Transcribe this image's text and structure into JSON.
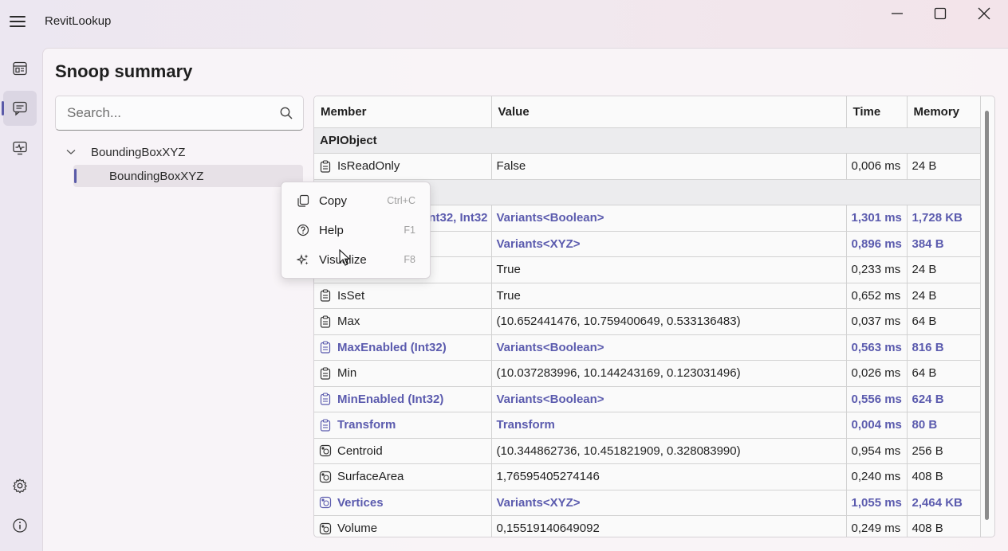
{
  "app": {
    "title": "RevitLookup"
  },
  "nav": {
    "items": [
      "dashboard-icon",
      "snoop-summary-icon",
      "monitor-icon",
      "settings-icon",
      "info-icon"
    ]
  },
  "page": {
    "title": "Snoop summary"
  },
  "search": {
    "placeholder": "Search..."
  },
  "tree": {
    "root": "BoundingBoxXYZ",
    "child": "BoundingBoxXYZ"
  },
  "table": {
    "headers": {
      "member": "Member",
      "value": "Value",
      "time": "Time",
      "memory": "Memory"
    },
    "groups": {
      "g1": "APIObject",
      "g2": ""
    },
    "rows": [
      {
        "icon": "property-icon",
        "member": "IsReadOnly",
        "value": "False",
        "time": "0,006 ms",
        "memory": "24 B"
      },
      {
        "icon": "property-icon",
        "member": "nt32, Int32",
        "value": "Variants<Boolean>",
        "time": "1,301 ms",
        "memory": "1,728 KB"
      },
      {
        "icon": "property-icon",
        "member": "",
        "value": "Variants<XYZ>",
        "time": "0,896 ms",
        "memory": "384 B"
      },
      {
        "icon": "property-icon",
        "member": "",
        "value": "True",
        "time": "0,233 ms",
        "memory": "24 B"
      },
      {
        "icon": "property-icon",
        "member": "IsSet",
        "value": "True",
        "time": "0,652 ms",
        "memory": "24 B"
      },
      {
        "icon": "property-icon",
        "member": "Max",
        "value": "(10.652441476, 10.759400649, 0.533136483)",
        "time": "0,037 ms",
        "memory": "64 B"
      },
      {
        "icon": "property-icon",
        "member": "MaxEnabled (Int32)",
        "value": "Variants<Boolean>",
        "time": "0,563 ms",
        "memory": "816 B"
      },
      {
        "icon": "property-icon",
        "member": "Min",
        "value": "(10.037283996, 10.144243169, 0.123031496)",
        "time": "0,026 ms",
        "memory": "64 B"
      },
      {
        "icon": "property-icon",
        "member": "MinEnabled (Int32)",
        "value": "Variants<Boolean>",
        "time": "0,556 ms",
        "memory": "624 B"
      },
      {
        "icon": "property-icon",
        "member": "Transform",
        "value": "Transform",
        "time": "0,004 ms",
        "memory": "80 B"
      },
      {
        "icon": "extension-icon",
        "member": "Centroid",
        "value": "(10.344862736, 10.451821909, 0.328083990)",
        "time": "0,954 ms",
        "memory": "256 B"
      },
      {
        "icon": "extension-icon",
        "member": "SurfaceArea",
        "value": "1,76595405274146",
        "time": "0,240 ms",
        "memory": "408 B"
      },
      {
        "icon": "extension-icon",
        "member": "Vertices",
        "value": "Variants<XYZ>",
        "time": "1,055 ms",
        "memory": "2,464 KB"
      },
      {
        "icon": "extension-icon",
        "member": "Volume",
        "value": "0,15519140649092",
        "time": "0,249 ms",
        "memory": "408 B"
      }
    ]
  },
  "context_menu": {
    "copy": {
      "label": "Copy",
      "shortcut": "Ctrl+C"
    },
    "help": {
      "label": "Help",
      "shortcut": "F1"
    },
    "visualize": {
      "label": "Visualize",
      "shortcut": "F8"
    }
  },
  "colors": {
    "accent": "#5b5bae",
    "text": "#222222"
  }
}
